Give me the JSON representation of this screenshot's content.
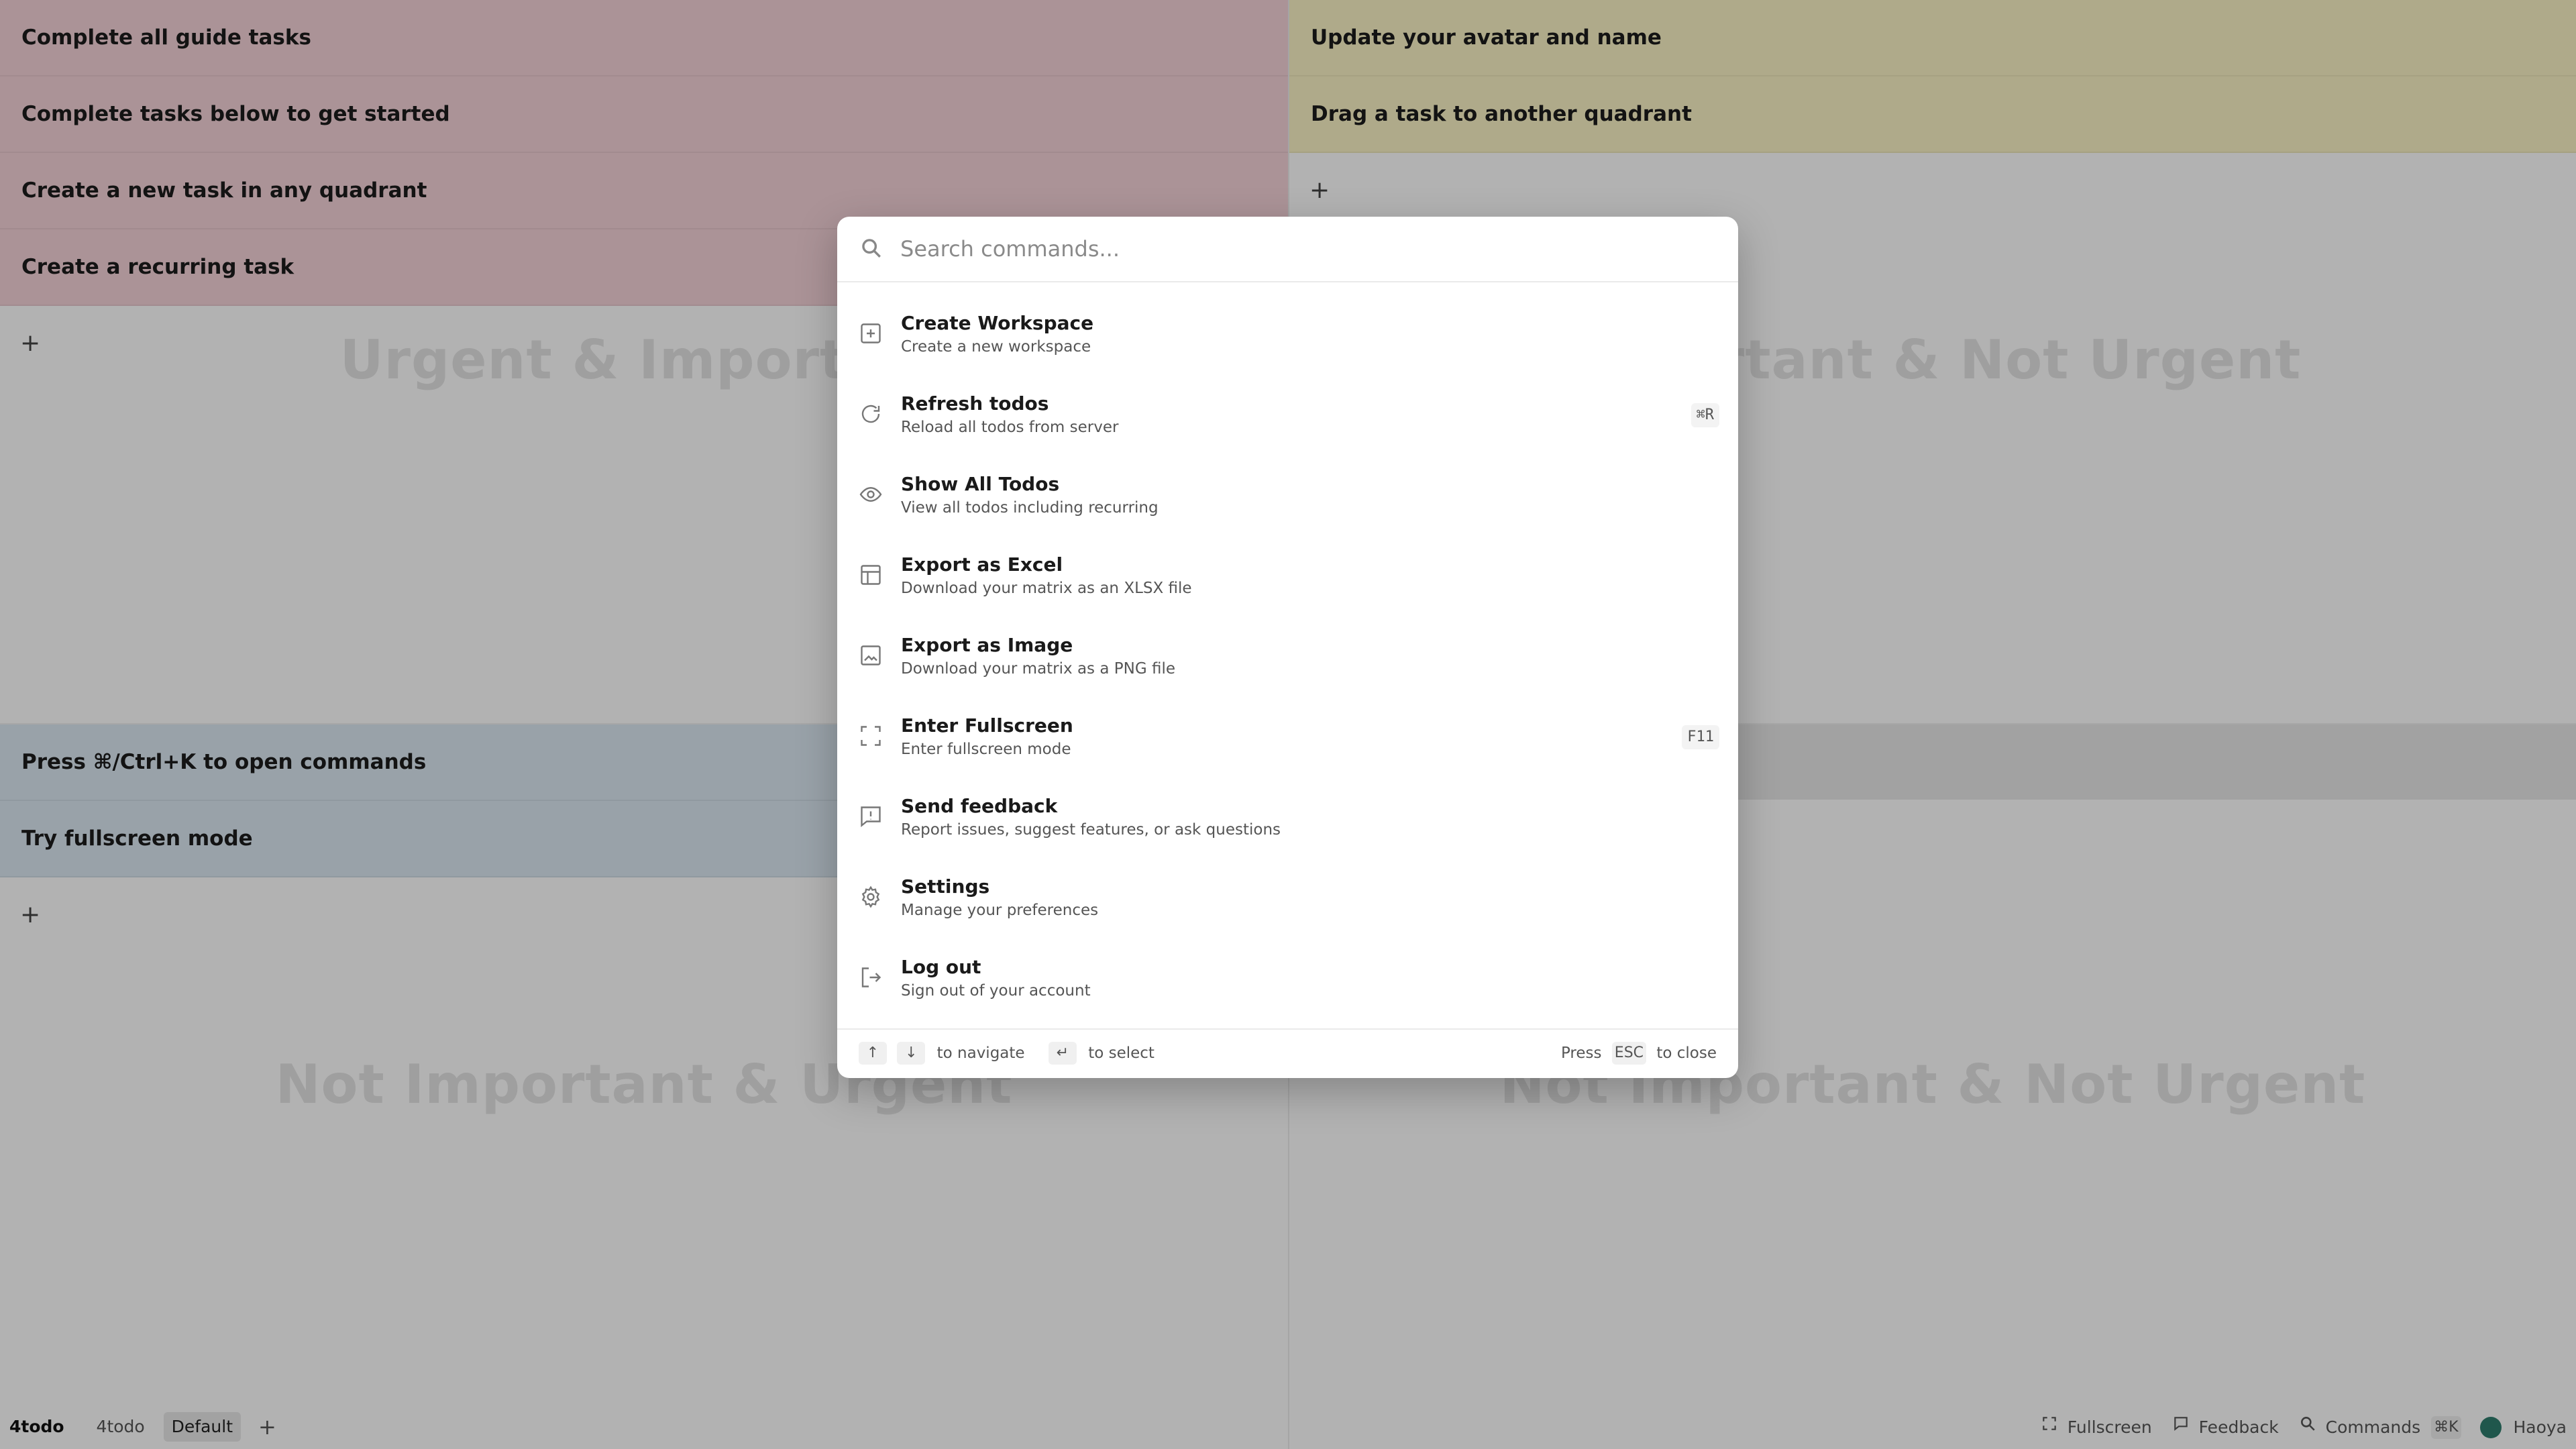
{
  "quadrants": {
    "urgent_important": {
      "title": "Urgent & Important",
      "color": "#f5d3d8",
      "tasks": [
        "Complete all guide tasks",
        "Complete tasks below to get started",
        "Create a new task in any quadrant",
        "Create a recurring task"
      ]
    },
    "important_not_urgent": {
      "title": "Important & Not Urgent",
      "color": "#fbf4c6",
      "tasks": [
        "Update your avatar and name",
        "Drag a task to another quadrant"
      ]
    },
    "not_important_urgent": {
      "title": "Not Important & Urgent",
      "color": "#dbe8f2",
      "tasks": [
        "Press ⌘/Ctrl+K to open commands",
        "Try fullscreen mode"
      ]
    },
    "not_important_not_urgent": {
      "title": "Not Important & Not Urgent",
      "tasks": []
    },
    "add_label": "+"
  },
  "palette": {
    "search_placeholder": "Search commands...",
    "commands": [
      {
        "icon": "plus-square-icon",
        "title": "Create Workspace",
        "desc": "Create a new workspace",
        "shortcut": ""
      },
      {
        "icon": "refresh-icon",
        "title": "Refresh todos",
        "desc": "Reload all todos from server",
        "shortcut": "⌘R"
      },
      {
        "icon": "eye-icon",
        "title": "Show All Todos",
        "desc": "View all todos including recurring",
        "shortcut": ""
      },
      {
        "icon": "table-icon",
        "title": "Export as Excel",
        "desc": "Download your matrix as an XLSX file",
        "shortcut": ""
      },
      {
        "icon": "image-icon",
        "title": "Export as Image",
        "desc": "Download your matrix as a PNG file",
        "shortcut": ""
      },
      {
        "icon": "fullscreen-icon",
        "title": "Enter Fullscreen",
        "desc": "Enter fullscreen mode",
        "shortcut": "F11"
      },
      {
        "icon": "feedback-icon",
        "title": "Send feedback",
        "desc": "Report issues, suggest features, or ask questions",
        "shortcut": ""
      },
      {
        "icon": "gear-icon",
        "title": "Settings",
        "desc": "Manage your preferences",
        "shortcut": ""
      },
      {
        "icon": "logout-icon",
        "title": "Log out",
        "desc": "Sign out of your account",
        "shortcut": ""
      }
    ],
    "footer": {
      "up_key": "↑",
      "down_key": "↓",
      "navigate_label": "to navigate",
      "enter_key": "↵",
      "select_label": "to select",
      "press_label": "Press",
      "esc_key": "ESC",
      "close_label": "to close"
    }
  },
  "bottom_bar": {
    "app_name": "4todo",
    "workspaces": [
      "4todo",
      "Default"
    ],
    "active_workspace": "Default",
    "add_workspace": "+",
    "fullscreen_label": "Fullscreen",
    "feedback_label": "Feedback",
    "commands_label": "Commands",
    "commands_shortcut": "⌘K",
    "user_name": "Haoya"
  }
}
